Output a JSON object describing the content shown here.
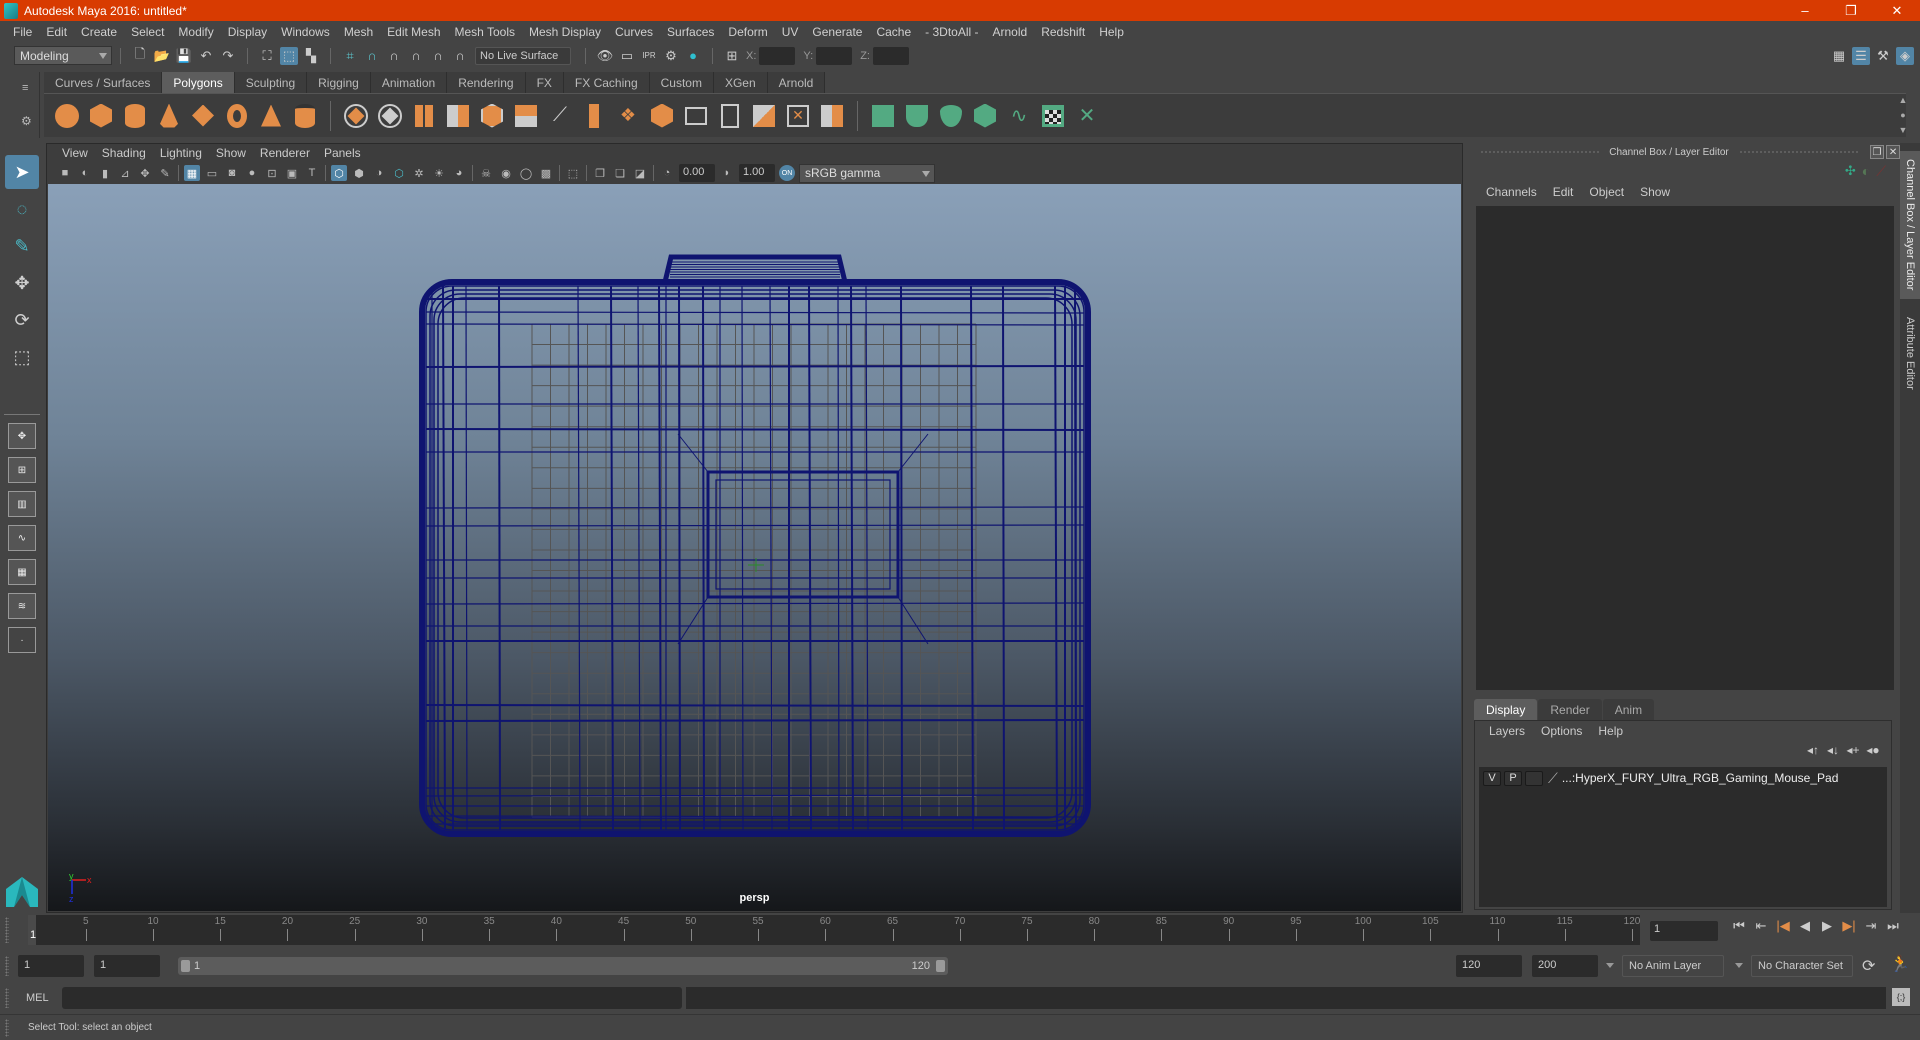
{
  "window": {
    "title": "Autodesk Maya 2016: untitled*",
    "controls": [
      "–",
      "❐",
      "✕"
    ]
  },
  "menubar": [
    "File",
    "Edit",
    "Create",
    "Select",
    "Modify",
    "Display",
    "Windows",
    "Mesh",
    "Edit Mesh",
    "Mesh Tools",
    "Mesh Display",
    "Curves",
    "Surfaces",
    "Deform",
    "UV",
    "Generate",
    "Cache",
    "- 3DtoAll -",
    "Arnold",
    "Redshift",
    "Help"
  ],
  "statusline": {
    "menuset": "Modeling",
    "live_surface": "No Live Surface",
    "x_label": "X:",
    "y_label": "Y:",
    "z_label": "Z:",
    "x_value": "",
    "y_value": "",
    "z_value": ""
  },
  "shelf": {
    "tabs": [
      "Curves / Surfaces",
      "Polygons",
      "Sculpting",
      "Rigging",
      "Animation",
      "Rendering",
      "FX",
      "FX Caching",
      "Custom",
      "XGen",
      "Arnold"
    ],
    "active_tab": "Polygons",
    "icons": [
      "poly-sphere-icon",
      "poly-cube-icon",
      "poly-cylinder-icon",
      "poly-cone-icon",
      "poly-plane-icon",
      "poly-torus-icon",
      "poly-pyramid-icon",
      "poly-pipe-icon",
      "combine-icon",
      "separate-icon",
      "smooth-icon",
      "mirror-icon",
      "bevel-icon",
      "bridge-icon",
      "extrude-icon",
      "multi-cut-icon",
      "target-weld-icon",
      "connect-icon",
      "insert-edge-loop-icon",
      "offset-edge-loop-icon",
      "fill-hole-icon",
      "reduce-icon",
      "triangulate-icon",
      "quadrangulate-icon"
    ],
    "uv_icons": [
      "planar-mapping-icon",
      "cylindrical-mapping-icon",
      "spherical-mapping-icon",
      "automatic-mapping-icon",
      "unfold-icon",
      "uv-editor-icon",
      "layout-uvs-icon"
    ]
  },
  "viewport": {
    "menu": [
      "View",
      "Shading",
      "Lighting",
      "Show",
      "Renderer",
      "Panels"
    ],
    "exposure": "0.00",
    "gamma": "1.00",
    "color_space": "sRGB gamma",
    "camera_label": "persp",
    "colors": {
      "wireframe": "#0f1470",
      "grid": "#555555"
    }
  },
  "channel_box": {
    "title": "Channel Box / Layer Editor",
    "menu": [
      "Channels",
      "Edit",
      "Object",
      "Show"
    ]
  },
  "layer_editor": {
    "tabs": [
      "Display",
      "Render",
      "Anim"
    ],
    "active_tab": "Display",
    "menu": [
      "Layers",
      "Options",
      "Help"
    ],
    "layers": [
      {
        "visible": "V",
        "playback": "P",
        "name": "...:HyperX_FURY_Ultra_RGB_Gaming_Mouse_Pad"
      }
    ]
  },
  "side_tabs": [
    "Channel Box / Layer Editor",
    "Attribute Editor"
  ],
  "timeline": {
    "ticks": [
      5,
      10,
      15,
      20,
      25,
      30,
      35,
      40,
      45,
      50,
      55,
      60,
      65,
      70,
      75,
      80,
      85,
      90,
      95,
      100,
      105,
      110,
      115,
      120
    ],
    "start": 1,
    "end": 120,
    "current_frame": "1"
  },
  "range": {
    "start_time": "1",
    "playback_start": "1",
    "slider_start": "1",
    "slider_end": "120",
    "playback_end": "120",
    "end_time": "200",
    "anim_layer": "No Anim Layer",
    "character_set": "No Character Set"
  },
  "playback_controls": [
    "⏮",
    "⇤",
    "|◀",
    "◀",
    "▶",
    "▶|",
    "⇥",
    "⏭"
  ],
  "mel": {
    "label": "MEL",
    "input": "",
    "output": ""
  },
  "helpline": "Select Tool: select an object",
  "colors": {
    "titlebar": "#d83b01",
    "accent": "#5285a6",
    "shelf_orange": "#e38d48",
    "shelf_green": "#53aa82"
  }
}
